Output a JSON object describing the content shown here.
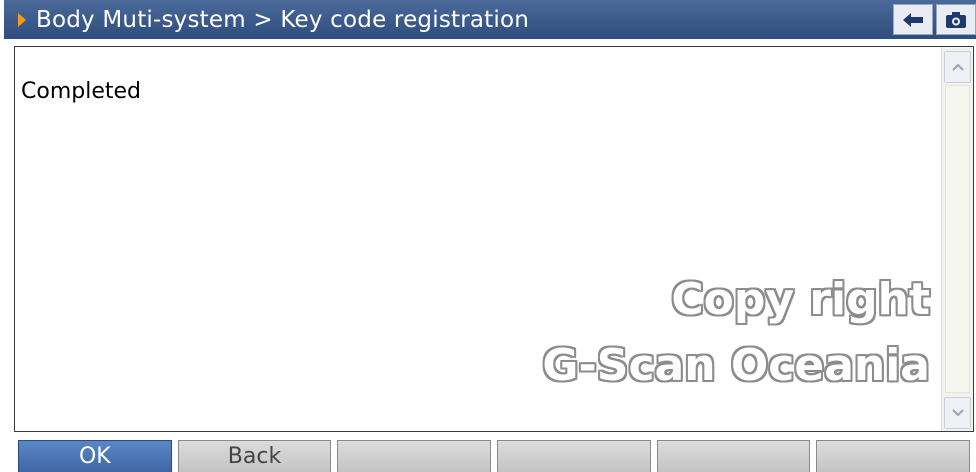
{
  "header": {
    "title": "Body Muti-system > Key code registration",
    "back_icon": "back-arrow-icon",
    "camera_icon": "camera-icon"
  },
  "content": {
    "message": "Completed"
  },
  "watermark": {
    "line1": "Copy right",
    "line2": "G-Scan Oceania"
  },
  "buttons": [
    {
      "label": "OK"
    },
    {
      "label": "Back"
    },
    {
      "label": ""
    },
    {
      "label": ""
    },
    {
      "label": ""
    },
    {
      "label": ""
    }
  ],
  "colors": {
    "titlebar": "#3a5a8c",
    "accent": "#f59a1c",
    "primary_button": "#4b74b5"
  }
}
